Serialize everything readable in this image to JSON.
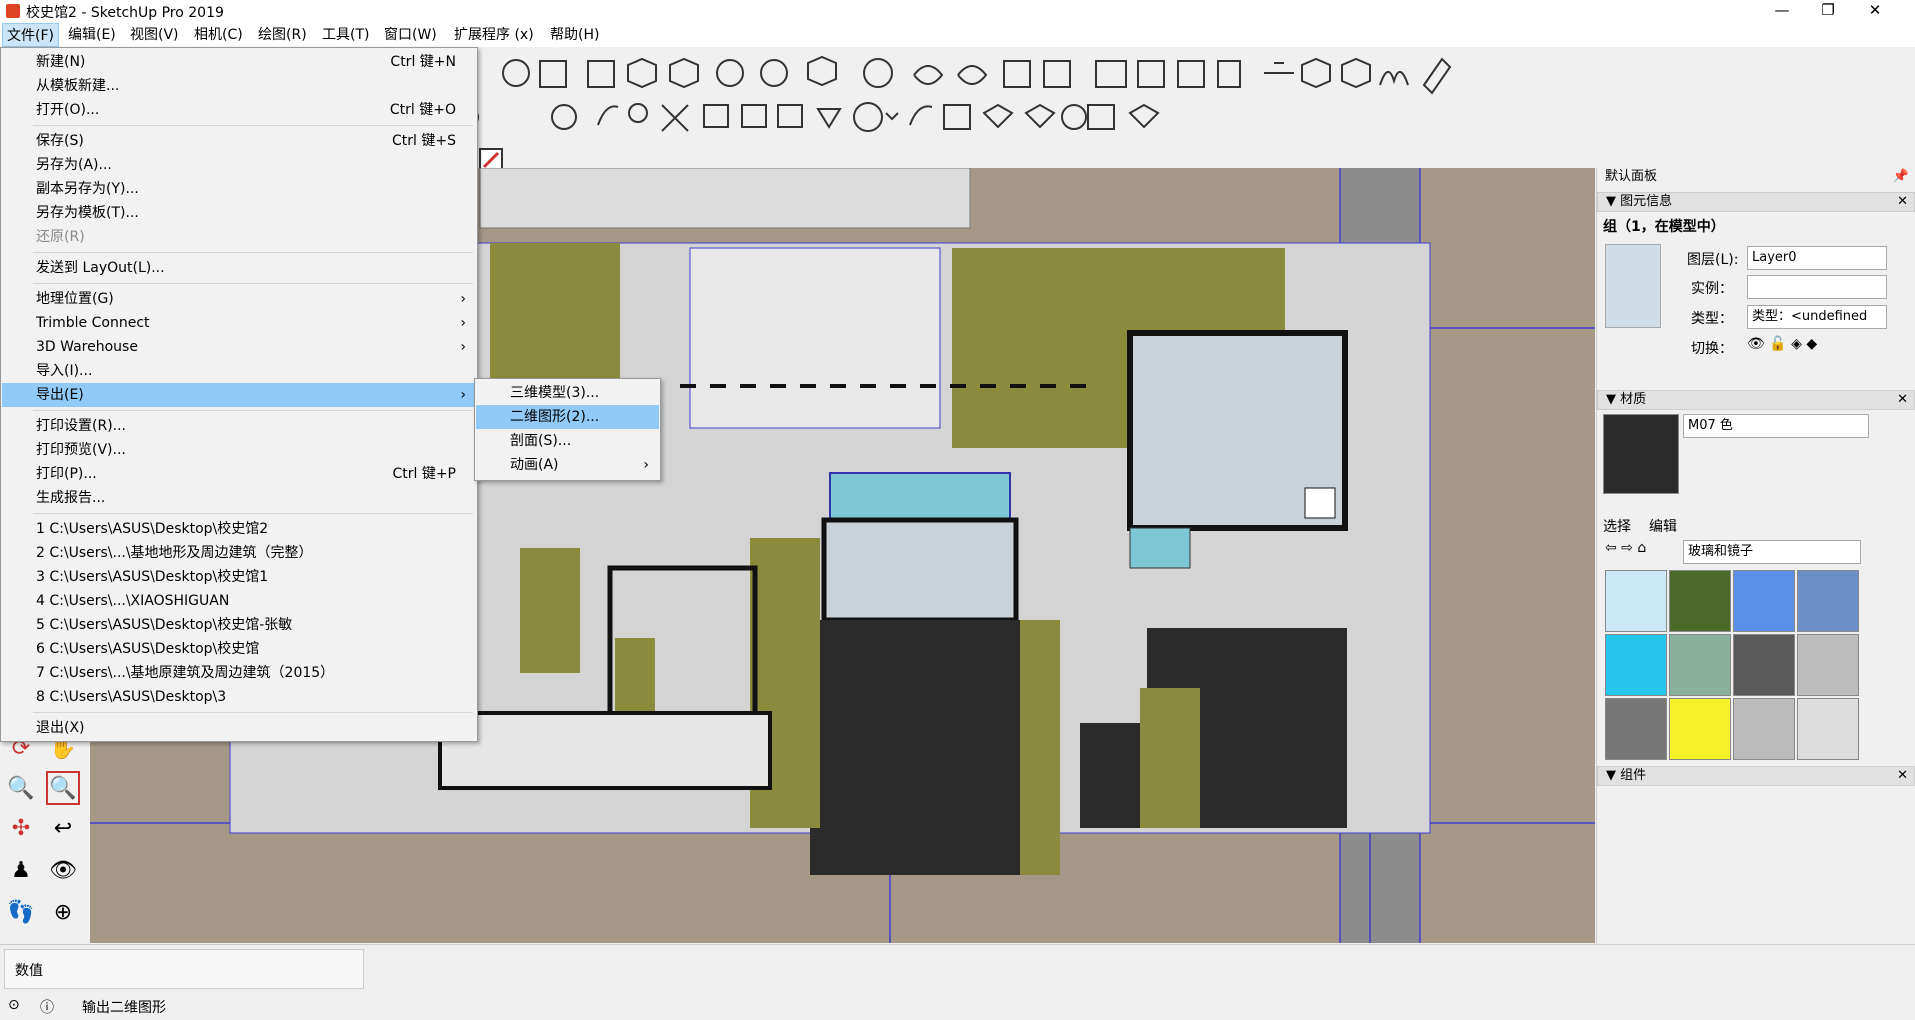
{
  "window": {
    "title": "校史馆2 - SketchUp Pro 2019",
    "minimize": "—",
    "maximize": "❐",
    "close": "✕"
  },
  "menubar": [
    "文件(F)",
    "编辑(E)",
    "视图(V)",
    "相机(C)",
    "绘图(R)",
    "工具(T)",
    "窗口(W)",
    "扩展程序 (x)",
    "帮助(H)"
  ],
  "file_menu": {
    "new": {
      "label": "新建(N)",
      "shortcut": "Ctrl 键+N"
    },
    "new_from_template": "从模板新建...",
    "open": {
      "label": "打开(O)...",
      "shortcut": "Ctrl 键+O"
    },
    "save": {
      "label": "保存(S)",
      "shortcut": "Ctrl 键+S"
    },
    "save_as": "另存为(A)...",
    "save_copy_as": "副本另存为(Y)...",
    "save_as_template": "另存为模板(T)...",
    "revert": "还原(R)",
    "send_to_layout": "发送到 LayOut(L)...",
    "geo_location": "地理位置(G)",
    "trimble_connect": "Trimble Connect",
    "warehouse": "3D Warehouse",
    "import": "导入(I)...",
    "export": "导出(E)",
    "print_setup": "打印设置(R)...",
    "print_preview": "打印预览(V)...",
    "print": {
      "label": "打印(P)...",
      "shortcut": "Ctrl 键+P"
    },
    "report": "生成报告...",
    "recent": [
      "1 C:\\Users\\ASUS\\Desktop\\校史馆2",
      "2 C:\\Users\\...\\基地地形及周边建筑（完整）",
      "3 C:\\Users\\ASUS\\Desktop\\校史馆1",
      "4 C:\\Users\\...\\XIAOSHIGUAN",
      "5 C:\\Users\\ASUS\\Desktop\\校史馆-张敏",
      "6 C:\\Users\\ASUS\\Desktop\\校史馆",
      "7 C:\\Users\\...\\基地原建筑及周边建筑（2015）",
      "8 C:\\Users\\ASUS\\Desktop\\3"
    ],
    "exit": "退出(X)"
  },
  "export_submenu": [
    "三维模型(3)...",
    "二维图形(2)...",
    "剖面(S)...",
    "动画(A)"
  ],
  "panel": {
    "tray_title": "默认面板",
    "entity_info": {
      "header": "图元信息",
      "summary": "组（1，在模型中）",
      "layer_label": "图层(L):",
      "layer_value": "Layer0",
      "instance_label": "实例：",
      "instance_value": "",
      "type_label": "类型：",
      "type_value": "类型：<undefined",
      "toggle_label": "切换："
    },
    "materials": {
      "header": "材质",
      "name_value": "M07 色",
      "tab_select": "选择",
      "tab_edit": "编辑",
      "library": "玻璃和镜子"
    },
    "third_header": "组件"
  },
  "statusbar": {
    "measurements_label": "数值",
    "status_text": "输出二维图形"
  },
  "colors": {
    "ground": "#a59887",
    "olive": "#8b8b3d",
    "building": "#2b2b2b",
    "paving": "#d4d4d4",
    "water": "#7fc7d4",
    "road": "#8c8c8c",
    "menu_highlight": "#91c9f7"
  }
}
